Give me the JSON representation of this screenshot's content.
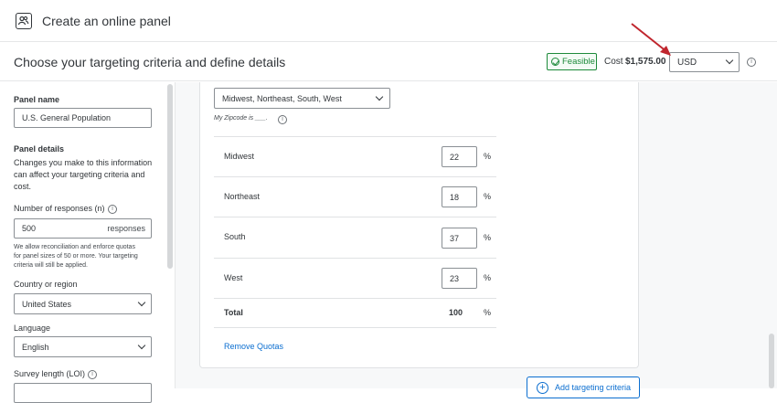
{
  "header": {
    "title": "Create an online panel"
  },
  "subheader": {
    "title": "Choose your targeting criteria and define details",
    "feasible_label": "Feasible",
    "cost_label": "Cost",
    "cost_value": "$1,575.00",
    "currency": "USD"
  },
  "sidebar": {
    "panel_name_label": "Panel name",
    "panel_name_value": "U.S. General Population",
    "panel_details_title": "Panel details",
    "panel_details_text_1": "Changes you make to this information",
    "panel_details_text_2": "can affect your targeting criteria and",
    "panel_details_text_3": "cost.",
    "responses_label": "Number of responses (n)",
    "responses_value": "500",
    "responses_suffix": "responses",
    "responses_note_1": "We allow reconciliation and enforce quotas",
    "responses_note_2": "for panel sizes of 50 or more. Your targeting",
    "responses_note_3": "criteria will still be applied.",
    "country_label": "Country or region",
    "country_value": "United States",
    "language_label": "Language",
    "language_value": "English",
    "loi_label": "Survey length (LOI)"
  },
  "main": {
    "region_dropdown": "Midwest, Northeast, South, West",
    "hint": "My Zipcode is ___.",
    "rows": [
      {
        "label": "Midwest",
        "value": "22"
      },
      {
        "label": "Northeast",
        "value": "18"
      },
      {
        "label": "South",
        "value": "37"
      },
      {
        "label": "West",
        "value": "23"
      }
    ],
    "pct_symbol": "%",
    "total_label": "Total",
    "total_value": "100",
    "remove_quotas": "Remove Quotas",
    "add_criteria": "Add targeting criteria"
  },
  "colors": {
    "accent": "#0b6ed0",
    "feasible": "#1d8a3a",
    "annotation_arrow": "#c0262e"
  }
}
